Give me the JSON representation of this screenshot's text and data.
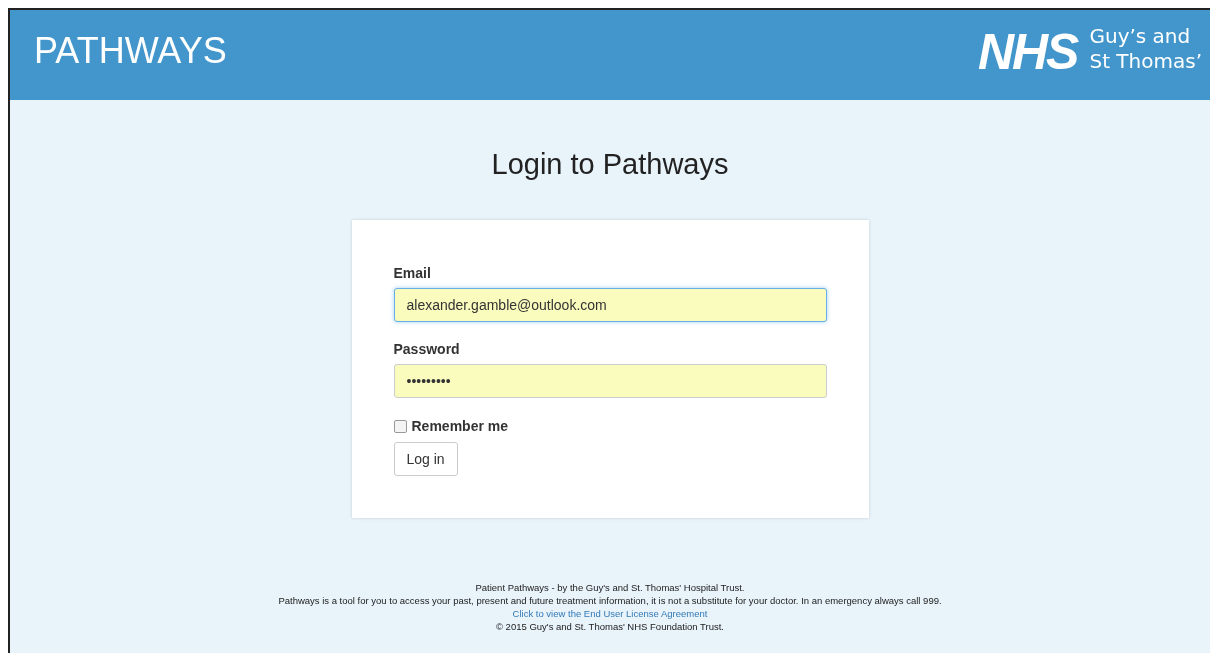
{
  "header": {
    "title": "PATHWAYS",
    "logo": {
      "mark": "NHS",
      "lines": [
        "Guy’s and",
        "St Thomas’"
      ]
    }
  },
  "heading": "Login to Pathways",
  "form": {
    "fields": [
      {
        "label": "Email",
        "value": "alexander.gamble@outlook.com",
        "focused": true
      },
      {
        "label": "Password",
        "value": "•••••••••",
        "focused": false
      }
    ],
    "remember": {
      "label": "Remember me",
      "checked": false
    },
    "button": "Log in"
  },
  "footer": {
    "lines": [
      {
        "kind": "text",
        "text": "Patient Pathways - by the Guy's and St. Thomas' Hospital Trust."
      },
      {
        "kind": "text",
        "text": "Pathways is a tool for you to access your past, present and future treatment information, it is not a substitute for your doctor. In an emergency always call 999."
      },
      {
        "kind": "link",
        "text": "Click to view the End User License Agreement"
      },
      {
        "kind": "text",
        "text": "© 2015 Guy's and St. Thomas' NHS Foundation Trust."
      }
    ]
  }
}
